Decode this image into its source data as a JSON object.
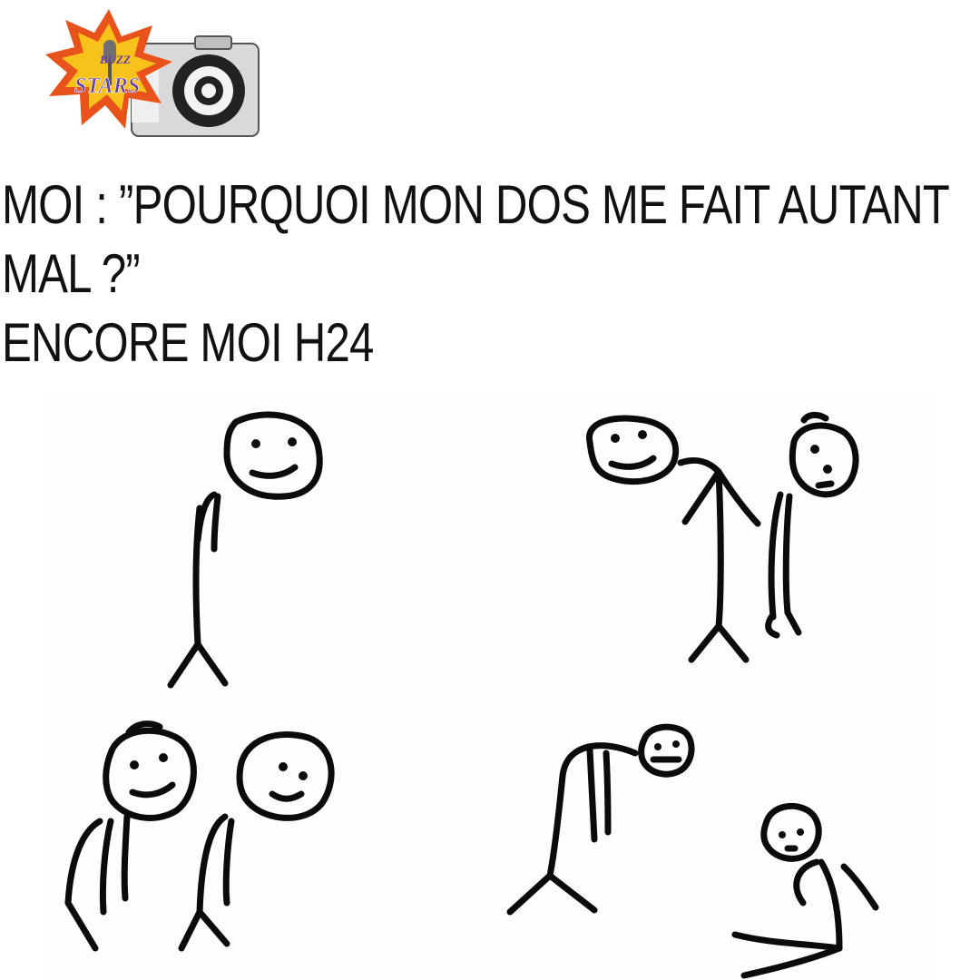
{
  "logo": {
    "line1": "BUZZ",
    "line2": "STARS",
    "icon": "camera-icon",
    "colors": {
      "burst_outer": "#e8531c",
      "burst_inner": "#f7c31a",
      "text": "#6a3fa3",
      "camera_body": "#d7d7d7",
      "camera_lens": "#1a1a1a"
    }
  },
  "caption": {
    "line1": "MOI : ”POURQUOI MON DOS  ME FAIT AUTANT",
    "line2": "MAL ?”",
    "line3": "ENCORE MOI H24"
  },
  "comic": {
    "panels": 4,
    "icon": "stick-figure-comic-illustration"
  }
}
